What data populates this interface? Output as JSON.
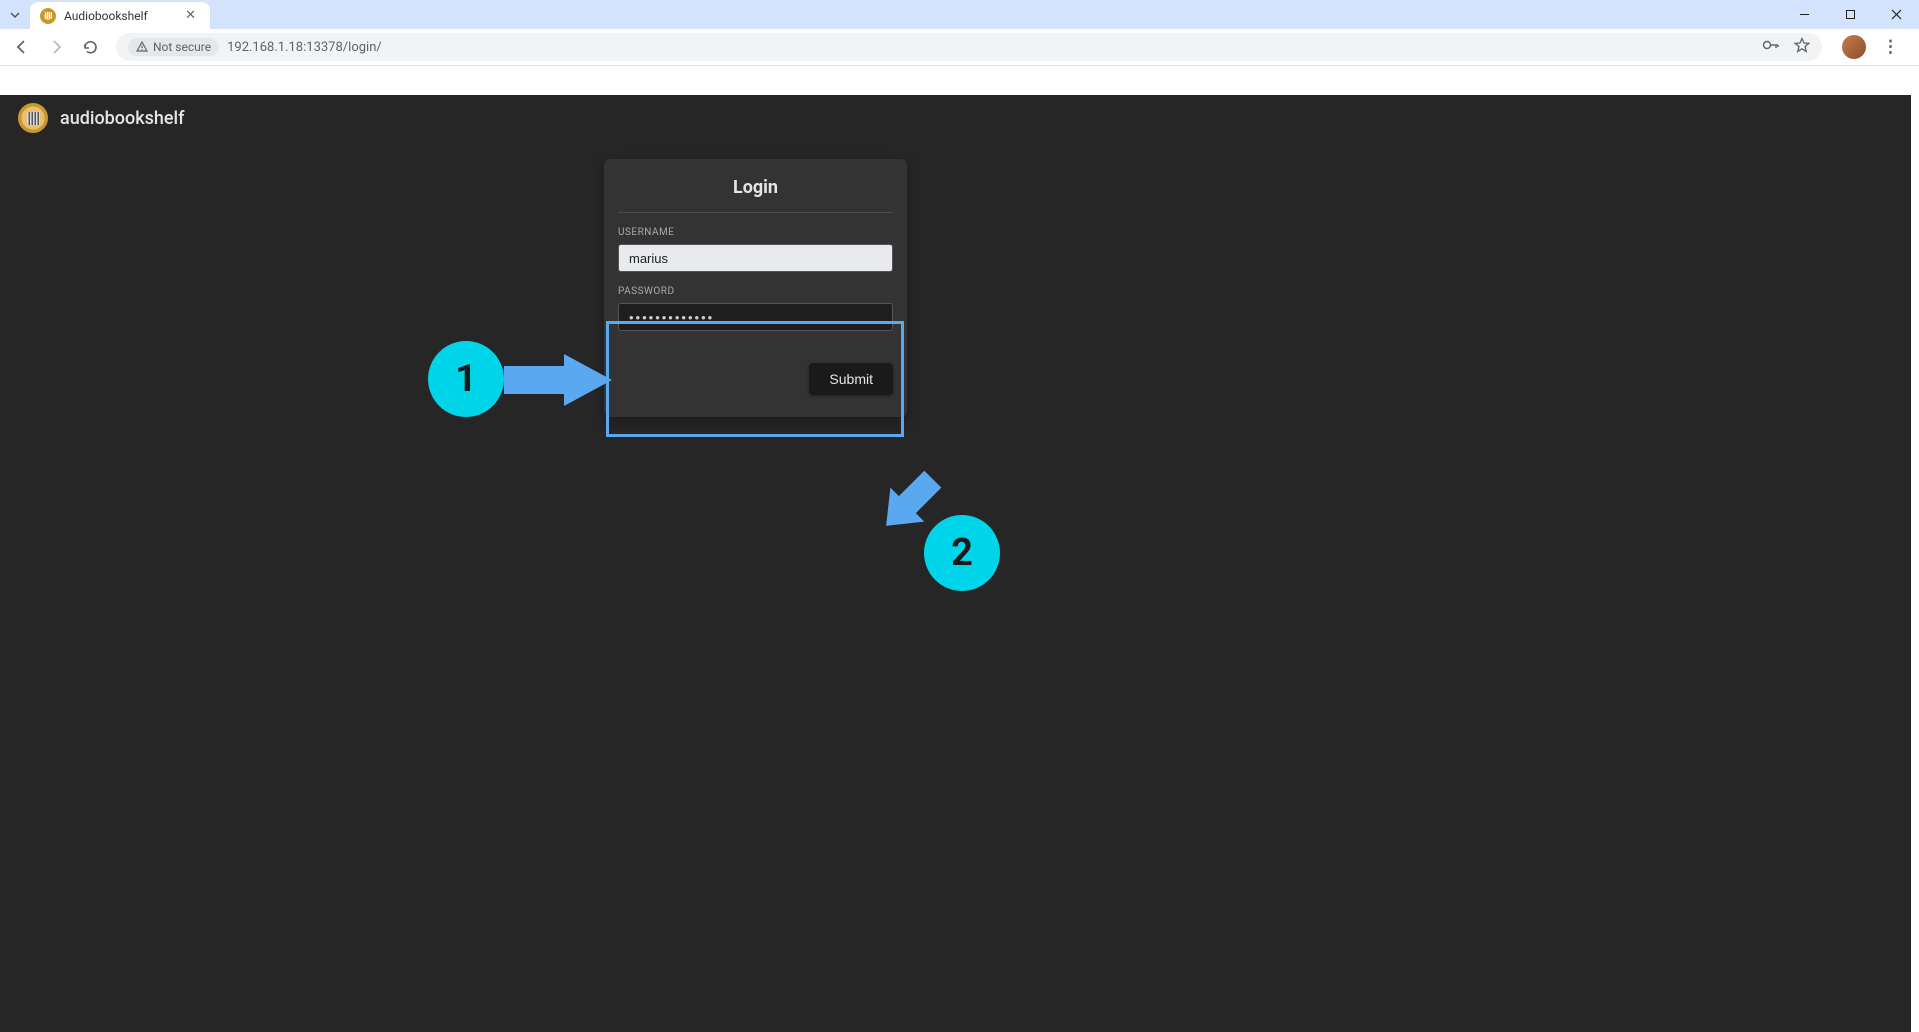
{
  "browser": {
    "tab_title": "Audiobookshelf",
    "security_label": "Not secure",
    "url": "192.168.1.18:13378/login/"
  },
  "app": {
    "name": "audiobookshelf"
  },
  "login": {
    "title": "Login",
    "username_label": "USERNAME",
    "username_value": "marius",
    "password_label": "PASSWORD",
    "password_value": "•••••••••••••",
    "submit_label": "Submit"
  },
  "annotations": {
    "step1": "1",
    "step2": "2"
  }
}
